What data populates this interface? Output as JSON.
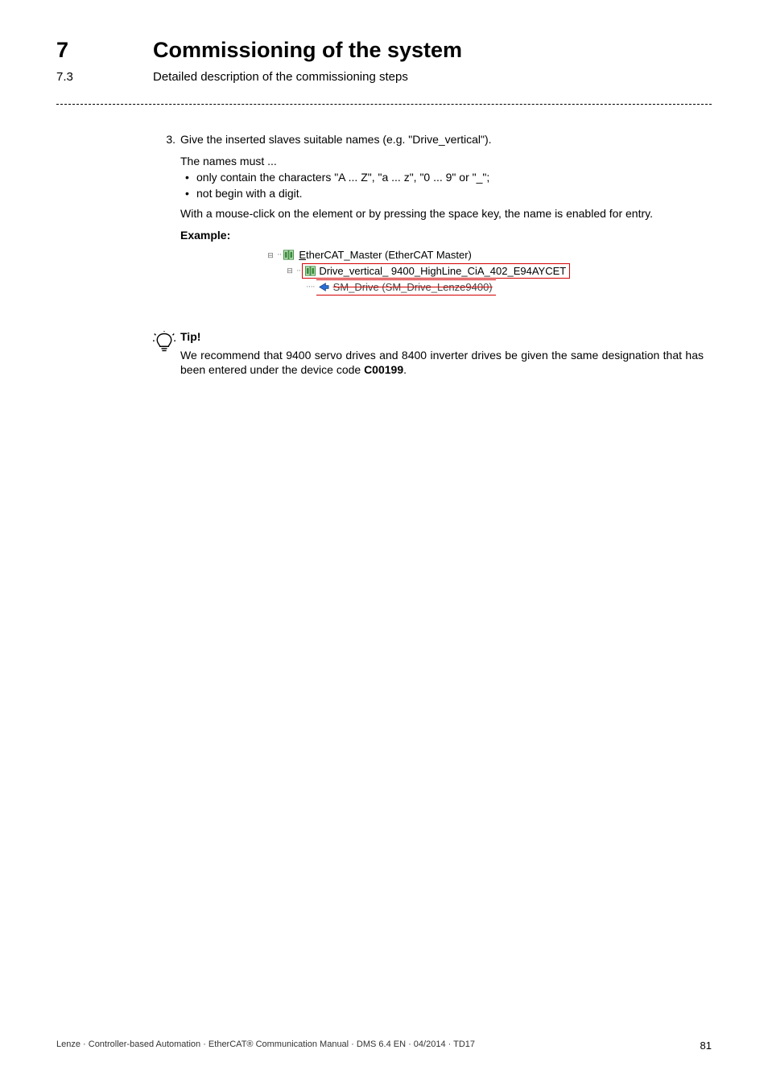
{
  "header": {
    "chapter_num": "7",
    "chapter_title": "Commissioning of the system",
    "section_num": "7.3",
    "section_title": "Detailed description of the commissioning steps"
  },
  "step": {
    "num": "3.",
    "text": "Give the inserted slaves suitable names (e.g. \"Drive_vertical\").",
    "names_intro": "The names must ...",
    "bullets": [
      "only contain the characters \"A ... Z\", \"a ... z\", \"0 ... 9\" or \"_\";",
      "not begin with a digit."
    ],
    "mouse_click": "With a mouse-click on the element or by pressing the space key, the name is enabled for entry.",
    "example_label": "Example:"
  },
  "tree": {
    "root_underline": "E",
    "root_rest": "therCAT_Master (EtherCAT Master)",
    "child_box": "Drive_vertical_ 9400_HighLine_CiA_402_E94AYCET",
    "grandchild": "SM_Drive (SM_Drive_Lenze9400)"
  },
  "tip": {
    "title": "Tip!",
    "body_a": "We recommend that 9400 servo drives and 8400 inverter drives be given the same designation that has been entered under the device code ",
    "code": "C00199",
    "body_b": "."
  },
  "footer": {
    "left": "Lenze · Controller-based Automation · EtherCAT® Communication Manual · DMS 6.4 EN · 04/2014 · TD17",
    "page": "81"
  }
}
